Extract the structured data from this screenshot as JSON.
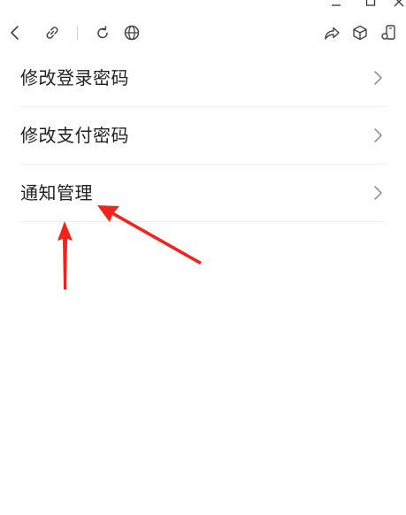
{
  "window": {
    "controls": [
      "minimize-icon",
      "maximize-icon",
      "close-icon"
    ]
  },
  "toolbar": {
    "icons": [
      "back-icon",
      "link-icon",
      "refresh-icon",
      "globe-icon",
      "share-icon",
      "cube-icon",
      "mini-program-icon"
    ]
  },
  "menu": {
    "items": [
      {
        "label": "修改登录密码"
      },
      {
        "label": "修改支付密码"
      },
      {
        "label": "通知管理"
      }
    ]
  },
  "annotation": {
    "arrow_color": "#f2231b"
  }
}
